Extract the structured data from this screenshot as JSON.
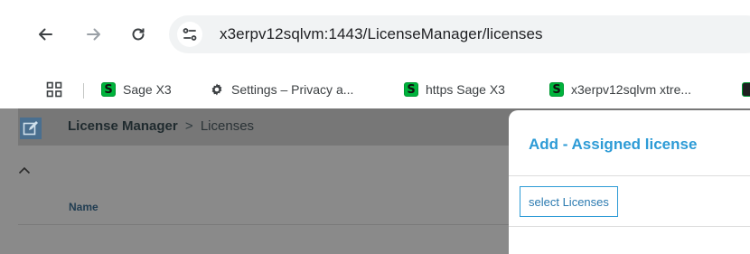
{
  "browser": {
    "url": "x3erpv12sqlvm:1443/LicenseManager/licenses",
    "icons": {
      "back": "arrow-left-icon",
      "forward": "arrow-right-icon",
      "reload": "reload-icon",
      "site_info": "tune-icon",
      "apps": "apps-grid-icon"
    }
  },
  "bookmarks": [
    {
      "label": "Sage X3",
      "favicon": "S"
    },
    {
      "label": "Settings – Privacy a...",
      "favicon": "gear-icon"
    },
    {
      "label": "https Sage X3",
      "favicon": "S"
    },
    {
      "label": "x3erpv12sqlvm xtre...",
      "favicon": "S"
    }
  ],
  "app": {
    "breadcrumb_root": "License Manager",
    "breadcrumb_separator": ">",
    "breadcrumb_current": "Licenses",
    "column_name": "Name"
  },
  "modal": {
    "title": "Add - Assigned license",
    "select_button": "select Licenses"
  },
  "colors": {
    "accent": "#2d9bd6",
    "sage_green": "#00b33c",
    "overlay_gray": "#8a8a8a"
  }
}
